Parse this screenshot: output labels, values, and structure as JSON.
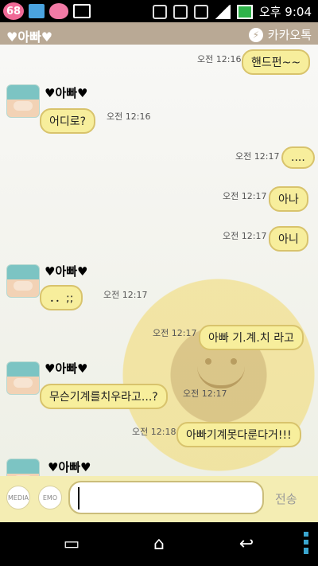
{
  "status_bar": {
    "badge": "68",
    "time": "오후 9:04",
    "icons": [
      "notification-icon",
      "paw-icon",
      "image-icon",
      "vibrate-icon",
      "alarm-icon",
      "wifi-icon",
      "signal-icon",
      "battery-icon"
    ]
  },
  "header": {
    "title": "♥아빠♥",
    "brand": "카카오톡",
    "brand_icon": "kakaotalk-icon"
  },
  "messages": [
    {
      "type": "me",
      "text": "핸드펀~~",
      "time": "오전 12:16"
    },
    {
      "type": "other",
      "sender": "♥아빠♥",
      "text": "어디로?",
      "time": "오전 12:16"
    },
    {
      "type": "me",
      "text": "....",
      "time": "오전 12:17"
    },
    {
      "type": "me",
      "text": "아나",
      "time": "오전 12:17"
    },
    {
      "type": "me",
      "text": "아니",
      "time": "오전 12:17"
    },
    {
      "type": "other",
      "sender": "♥아빠♥",
      "text": "．．;;",
      "time": "오전 12:17"
    },
    {
      "type": "me",
      "text": "아빠 기.계.치 라고",
      "time": "오전 12:17"
    },
    {
      "type": "other",
      "sender": "♥아빠♥",
      "text": "무슨기계를치우라고...?",
      "time": "오전 12:17"
    },
    {
      "type": "me",
      "text": "아빠기계못다룬다거!!!",
      "time": "오전 12:18"
    },
    {
      "type": "other",
      "sender": "♥아빠♥",
      "text": "",
      "time": ""
    }
  ],
  "input": {
    "media_label": "MEDIA",
    "emo_label": "EMO",
    "placeholder": "",
    "send_label": "전송"
  },
  "nav": {
    "recent_icon": "recent-apps-icon",
    "home_icon": "home-icon",
    "back_icon": "back-icon",
    "menu_icon": "menu-icon"
  }
}
